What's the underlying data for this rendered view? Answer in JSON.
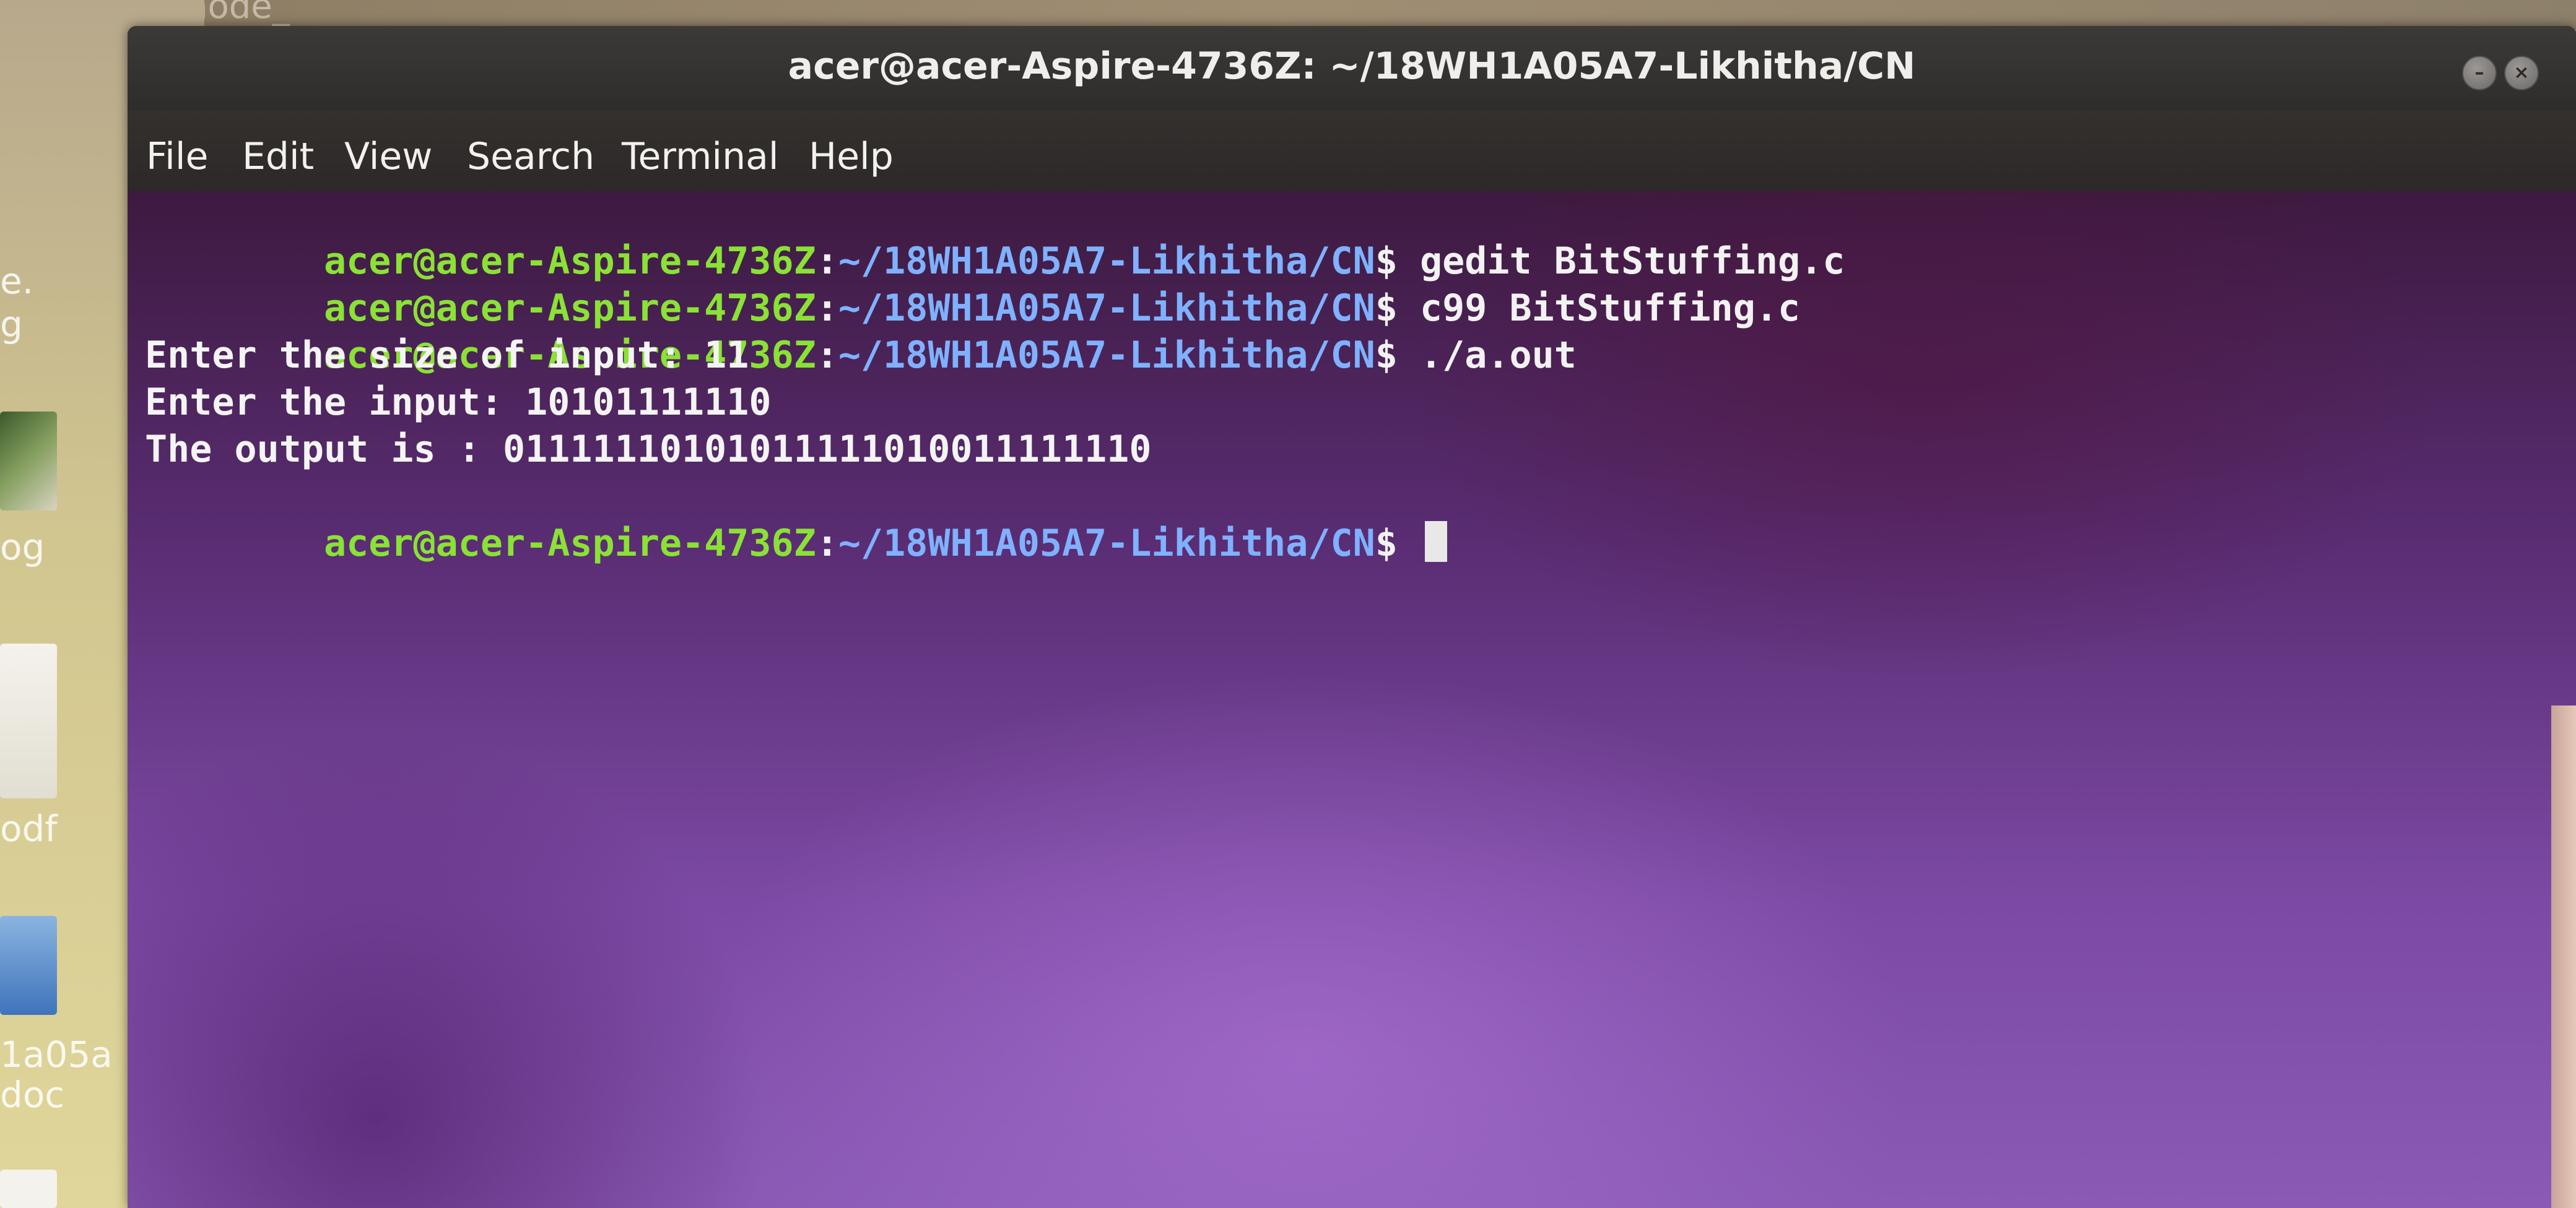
{
  "desktop": {
    "top_label": "node_",
    "labels": [
      "e.",
      "g",
      "og",
      "odf",
      "1a05a",
      "doc"
    ]
  },
  "window": {
    "title": "acer@acer-Aspire-4736Z: ~/18WH1A05A7-Likhitha/CN",
    "buttons": [
      "minimize",
      "close"
    ]
  },
  "menubar": {
    "items": [
      "File",
      "Edit",
      "View",
      "Search",
      "Terminal",
      "Help"
    ]
  },
  "terminal": {
    "prompt_user": "acer@acer-Aspire-4736Z",
    "prompt_colon": ":",
    "prompt_path": "~/18WH1A05A7-Likhitha/CN",
    "prompt_dollar": "$",
    "commands": [
      "gedit BitStuffing.c",
      "c99 BitStuffing.c",
      "./a.out"
    ],
    "output": [
      "Enter the size of input: 11",
      "Enter the input: 10101111110",
      "The output is : 01111110101011111010011111110"
    ]
  },
  "colors": {
    "prompt_user": "#8ae234",
    "prompt_path": "#7fb1ff",
    "terminal_bg": "#5a2d74",
    "titlebar_bg": "#3c3a38"
  }
}
